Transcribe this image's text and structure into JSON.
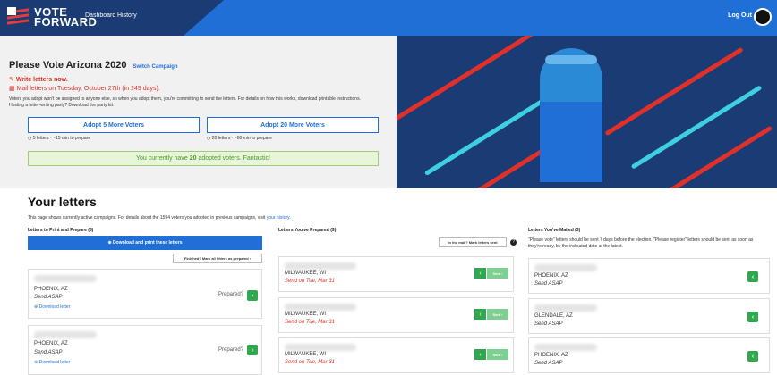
{
  "nav": {
    "logo_top": "VOTE",
    "logo_bottom": "FORWARD",
    "links": [
      "Dashboard",
      "History"
    ],
    "logout": "Log Out"
  },
  "campaign": {
    "title": "Please Vote Arizona 2020",
    "switch_label": "Switch Campaign",
    "write_label": "Write letters now.",
    "mail_label": "Mail letters on Tuesday, October 27th (in 249 days).",
    "blurb": "Voters you adopt won't be assigned to anyone else, so when you adopt them, you're committing to send the letters. For details on how this works, download printable instructions. Hosting a letter-writing party? Download the party kit.",
    "adopt5": "Adopt 5 More Voters",
    "adopt5_note": "5 letters · ~15 min to prepare",
    "adopt20": "Adopt 20 More Voters",
    "adopt20_note": "20 letters · ~60 min to prepare",
    "adopted_prefix": "You currently have",
    "adopted_count": "20",
    "adopted_suffix": "adopted voters. Fantastic!"
  },
  "letters": {
    "heading": "Your letters",
    "intro_text": "This page shows currently active campaigns. For details about the 1594 voters you adopted in previous campaigns, visit",
    "intro_link": "your history.",
    "col1": {
      "heading": "Letters to Print and Prepare (8)",
      "download_btn": "⊕ Download and print these letters",
      "mark_btn": "Finished? Mark all letters as prepared ›",
      "items": [
        {
          "city": "PHOENIX, AZ",
          "when": "Send ASAP",
          "link": "⊕ Download letter",
          "prepared": "Prepared?"
        },
        {
          "city": "PHOENIX, AZ",
          "when": "Send ASAP",
          "link": "⊕ Download letter",
          "prepared": "Prepared?"
        }
      ]
    },
    "col2": {
      "heading": "Letters You've Prepared (9)",
      "mark_btn": "In the mail? Mark letters sent",
      "items": [
        {
          "city": "MILWAUKEE, WI",
          "when": "Send on Tue, Mar 31",
          "sent": "Sent ›"
        },
        {
          "city": "MILWAUKEE, WI",
          "when": "Send on Tue, Mar 31",
          "sent": "Sent ›"
        },
        {
          "city": "MILWAUKEE, WI",
          "when": "Send on Tue, Mar 31",
          "sent": "Sent ›"
        }
      ]
    },
    "col3": {
      "heading": "Letters You've Mailed (3)",
      "note": "\"Please vote\" letters should be sent 7 days before the election. \"Please register\" letters should be sent as soon as they're ready, by the indicated date at the latest.",
      "items": [
        {
          "city": "PHOENIX, AZ",
          "when": "Send ASAP"
        },
        {
          "city": "GLENDALE, AZ",
          "when": "Send ASAP"
        },
        {
          "city": "PHOENIX, AZ",
          "when": "Send ASAP"
        }
      ]
    }
  },
  "colors": {
    "nav_blue": "#1f6fd6",
    "nav_dark": "#1a3b73",
    "accent_red": "#e0302a",
    "success_green": "#2fa84f"
  }
}
